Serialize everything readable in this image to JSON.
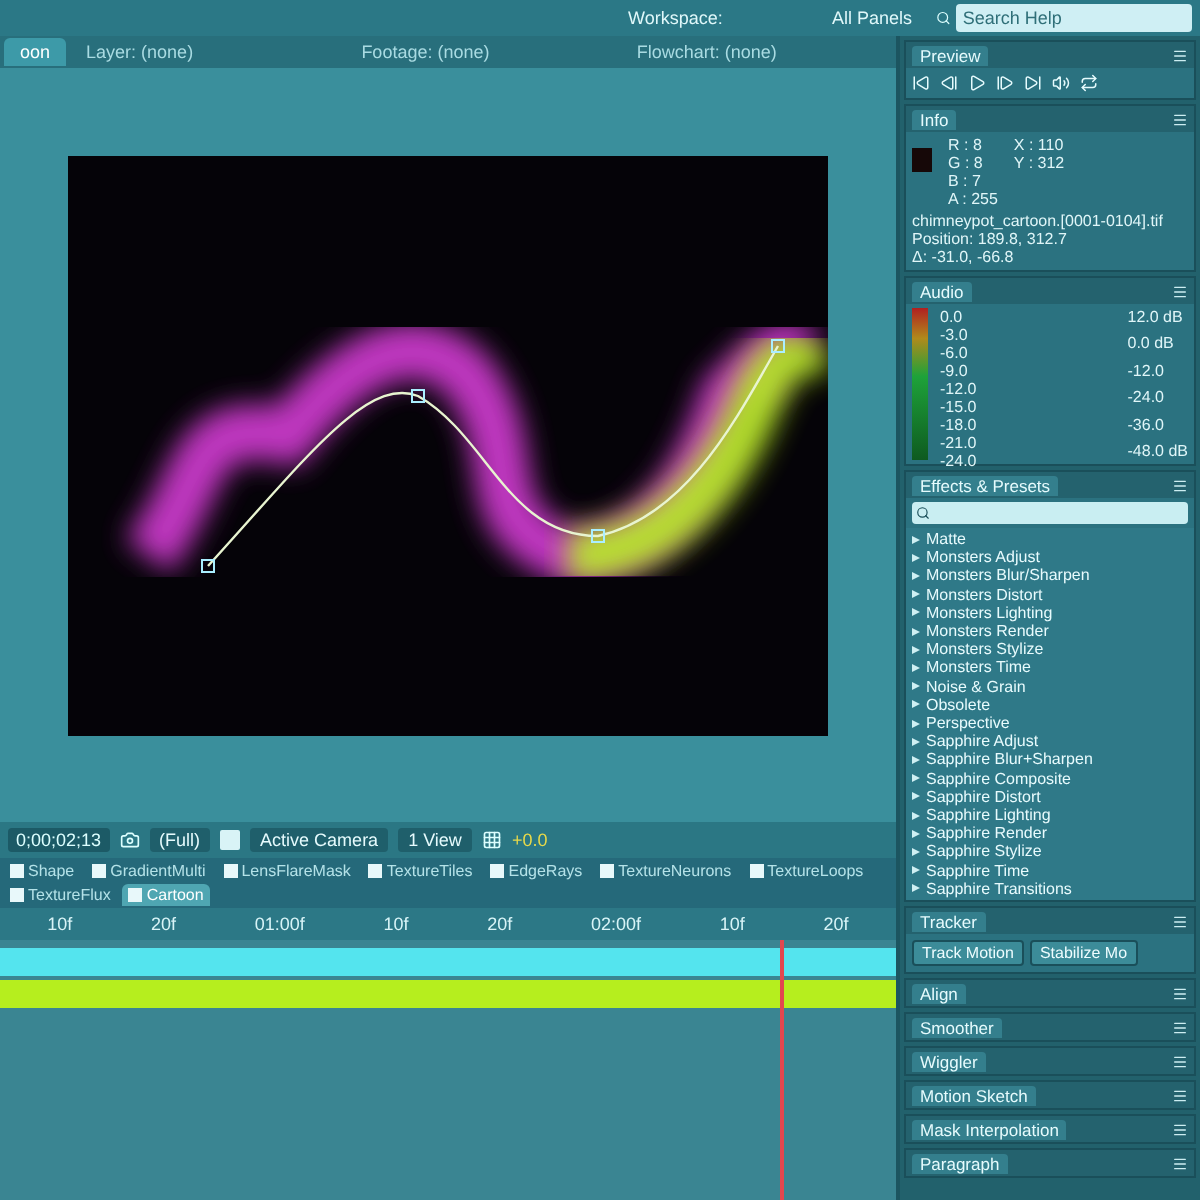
{
  "workspace": {
    "label": "Workspace:",
    "value": "All Panels"
  },
  "search": {
    "placeholder": "Search Help"
  },
  "viewer": {
    "tabs": [
      {
        "label": "oon",
        "selected": true
      },
      {
        "label": "Layer: (none)",
        "selected": false
      },
      {
        "label": "Footage: (none)",
        "selected": false
      },
      {
        "label": "Flowchart: (none)",
        "selected": false
      }
    ],
    "zoom": "(Full)",
    "camera": "Active Camera",
    "views": "1 View",
    "exposure": "+0.0"
  },
  "timeline": {
    "tabs": [
      {
        "label": "Shape",
        "selected": false
      },
      {
        "label": "GradientMulti",
        "selected": false
      },
      {
        "label": "LensFlareMask",
        "selected": false
      },
      {
        "label": "TextureTiles",
        "selected": false
      },
      {
        "label": "EdgeRays",
        "selected": false
      },
      {
        "label": "TextureNeurons",
        "selected": false
      },
      {
        "label": "TextureLoops",
        "selected": false
      },
      {
        "label": "TextureFlux",
        "selected": false
      },
      {
        "label": "Cartoon",
        "selected": true
      }
    ],
    "timecode": "0;00;02;13",
    "ruler": [
      "10f",
      "20f",
      "01:00f",
      "10f",
      "20f",
      "02:00f",
      "10f",
      "20f"
    ],
    "playhead": {
      "level": 0.87
    },
    "layers": [
      {
        "color": "#54e4ee"
      },
      {
        "color": "#b6ee1e"
      }
    ]
  },
  "preview": {
    "title": "Preview"
  },
  "info": {
    "title": "Info",
    "channels": [
      "R : 8",
      "G : 8",
      "B : 7",
      "A : 255"
    ],
    "coords": [
      "X : 110",
      "Y : 312"
    ],
    "file": "chimneypot_cartoon.[0001-0104].tif",
    "position": "Position: 189.8, 312.7",
    "delta": "Δ: -31.0, -66.8"
  },
  "audio": {
    "title": "Audio",
    "left_scale": [
      "0.0",
      "-3.0",
      "-6.0",
      "-9.0",
      "-12.0",
      "-15.0",
      "-18.0",
      "-21.0",
      "-24.0"
    ],
    "right_scale": [
      "12.0 dB",
      "0.0 dB",
      "-12.0",
      "-24.0",
      "-36.0",
      "-48.0 dB"
    ]
  },
  "effects": {
    "title": "Effects & Presets",
    "items": [
      {
        "label": "Matte",
        "expanded": false
      },
      {
        "label": "Monsters Adjust",
        "expanded": false
      },
      {
        "label": "Monsters Blur/Sharpen",
        "expanded": false
      },
      {
        "label": "Monsters Distort",
        "expanded": false
      },
      {
        "label": "Monsters Lighting",
        "expanded": false
      },
      {
        "label": "Monsters Render",
        "expanded": false
      },
      {
        "label": "Monsters Stylize",
        "expanded": false
      },
      {
        "label": "Monsters Time",
        "expanded": false
      },
      {
        "label": "Noise & Grain",
        "expanded": false
      },
      {
        "label": "Obsolete",
        "expanded": false
      },
      {
        "label": "Perspective",
        "expanded": false
      },
      {
        "label": "Sapphire Adjust",
        "expanded": false
      },
      {
        "label": "Sapphire Blur+Sharpen",
        "expanded": false
      },
      {
        "label": "Sapphire Composite",
        "expanded": false
      },
      {
        "label": "Sapphire Distort",
        "expanded": false
      },
      {
        "label": "Sapphire Lighting",
        "expanded": false
      },
      {
        "label": "Sapphire Render",
        "expanded": false
      },
      {
        "label": "Sapphire Stylize",
        "expanded": false
      },
      {
        "label": "Sapphire Time",
        "expanded": false
      },
      {
        "label": "Sapphire Transitions",
        "expanded": false
      }
    ]
  },
  "tracker": {
    "title": "Tracker",
    "buttons": [
      "Track Motion",
      "Stabilize Mo"
    ]
  },
  "panels": [
    "Align",
    "Smoother",
    "Wiggler",
    "Motion Sketch",
    "Mask Interpolation",
    "Paragraph"
  ]
}
